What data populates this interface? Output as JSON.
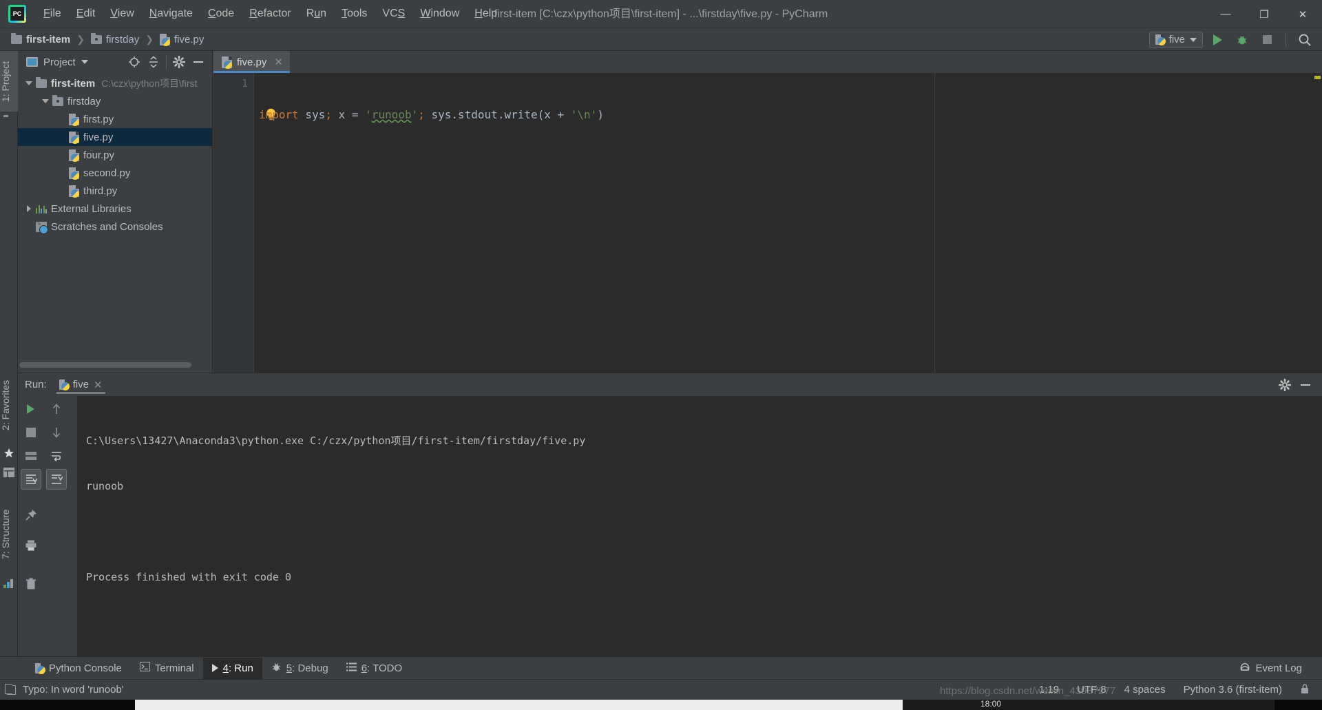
{
  "window": {
    "title": "first-item [C:\\czx\\python项目\\first-item] - ...\\firstday\\five.py - PyCharm",
    "minimize_label": "—",
    "maximize_label": "❐",
    "close_label": "✕"
  },
  "menubar": {
    "items": [
      {
        "label": "File",
        "mnemonic": "F",
        "rest": "ile"
      },
      {
        "label": "Edit",
        "mnemonic": "E",
        "rest": "dit"
      },
      {
        "label": "View",
        "mnemonic": "V",
        "rest": "iew"
      },
      {
        "label": "Navigate",
        "mnemonic": "N",
        "rest": "avigate"
      },
      {
        "label": "Code",
        "mnemonic": "C",
        "rest": "ode"
      },
      {
        "label": "Refactor",
        "mnemonic": "R",
        "rest": "efactor"
      },
      {
        "label": "Run",
        "mnemonic": "R",
        "rest": "un"
      },
      {
        "label": "Tools",
        "mnemonic": "T",
        "rest": "ools"
      },
      {
        "label": "VCS",
        "mnemonic": "S",
        "rest": "VC"
      },
      {
        "label": "Window",
        "mnemonic": "W",
        "rest": "indow"
      },
      {
        "label": "Help",
        "mnemonic": "H",
        "rest": "elp"
      }
    ]
  },
  "navbar": {
    "breadcrumbs": [
      {
        "label": "first-item",
        "icon": "folder-icon"
      },
      {
        "label": "firstday",
        "icon": "source-folder-icon"
      },
      {
        "label": "five.py",
        "icon": "python-file-icon"
      }
    ],
    "separator": "❯",
    "run_config": {
      "label": "five",
      "icon": "python-icon",
      "dropdown": "▾"
    },
    "run_button": "run-button",
    "debug_button": "debug-button",
    "stop_button": "stop-button",
    "search_button": "search-everywhere-button"
  },
  "left_stripe": {
    "tabs": [
      {
        "label": "1: Project",
        "active": true
      },
      {
        "label": "2: Favorites",
        "active": false
      },
      {
        "label": "7: Structure",
        "active": false
      }
    ]
  },
  "project_panel": {
    "title": "Project",
    "dropdown": "▾",
    "buttons": [
      "locate-icon",
      "collapse-all-icon",
      "settings-icon",
      "hide-icon"
    ],
    "tree": [
      {
        "label": "first-item",
        "path": "C:\\czx\\python项目\\first",
        "icon": "folder-icon",
        "twist": "open",
        "indent": 0,
        "bold": true,
        "selected": false
      },
      {
        "label": "firstday",
        "path": "",
        "icon": "source-folder-icon",
        "twist": "open",
        "indent": 1,
        "bold": false,
        "selected": false
      },
      {
        "label": "first.py",
        "path": "",
        "icon": "python-file-icon",
        "twist": "none",
        "indent": 2,
        "bold": false,
        "selected": false
      },
      {
        "label": "five.py",
        "path": "",
        "icon": "python-file-icon",
        "twist": "none",
        "indent": 2,
        "bold": false,
        "selected": true
      },
      {
        "label": "four.py",
        "path": "",
        "icon": "python-file-icon",
        "twist": "none",
        "indent": 2,
        "bold": false,
        "selected": false
      },
      {
        "label": "second.py",
        "path": "",
        "icon": "python-file-icon",
        "twist": "none",
        "indent": 2,
        "bold": false,
        "selected": false
      },
      {
        "label": "third.py",
        "path": "",
        "icon": "python-file-icon",
        "twist": "none",
        "indent": 2,
        "bold": false,
        "selected": false
      },
      {
        "label": "External Libraries",
        "path": "",
        "icon": "library-icon",
        "twist": "closed",
        "indent": 0,
        "bold": false,
        "selected": false
      },
      {
        "label": "Scratches and Consoles",
        "path": "",
        "icon": "scratches-icon",
        "twist": "none",
        "indent": 0,
        "bold": false,
        "selected": false
      }
    ]
  },
  "editor": {
    "tab": {
      "label": "five.py",
      "icon": "python-file-icon",
      "close": "✕"
    },
    "line_number": "1",
    "code": {
      "kw_import": "import",
      "after_import": " sys",
      "semi1": ";",
      "mid": " x = ",
      "quote_open": "'",
      "string_value": "runoob",
      "quote_close": "'",
      "semi2": ";",
      "tail": " sys.stdout.write(x + ",
      "newline_literal": "'\\n'",
      "end": ")"
    },
    "intention_bulb": "intention-bulb-icon"
  },
  "run_panel": {
    "label": "Run:",
    "tab": {
      "label": "five",
      "icon": "python-icon",
      "close": "✕"
    },
    "settings_button": "settings-icon",
    "hide_button": "hide-icon",
    "gutter_buttons": [
      "rerun-button",
      "stop-button",
      "print-layers-button",
      "scroll-down-button"
    ],
    "gutter2_buttons": [
      "up-stack-button",
      "down-stack-button",
      "soft-wrap-button",
      "scroll-to-end-button",
      "pin-button",
      "print-button",
      "clear-all-button"
    ],
    "console": {
      "command": "C:\\Users\\13427\\Anaconda3\\python.exe C:/czx/python项目/first-item/firstday/five.py",
      "output": "runoob",
      "exit": "Process finished with exit code 0"
    }
  },
  "tool_window_bar": {
    "items": [
      {
        "label": "Python Console",
        "icon": "python-icon",
        "active": false,
        "mnemonic": "",
        "rest": "Python Console"
      },
      {
        "label": "Terminal",
        "icon": "terminal-icon",
        "active": false,
        "mnemonic": "",
        "rest": "Terminal"
      },
      {
        "label": "4: Run",
        "icon": "run-icon",
        "active": true,
        "mnemonic": "4",
        "rest": ": Run"
      },
      {
        "label": "5: Debug",
        "icon": "debug-icon",
        "active": false,
        "mnemonic": "5",
        "rest": ": Debug"
      },
      {
        "label": "6: TODO",
        "icon": "todo-icon",
        "active": false,
        "mnemonic": "6",
        "rest": ": TODO"
      }
    ],
    "event_log": {
      "label": "Event Log",
      "icon": "event-log-icon"
    }
  },
  "statusbar": {
    "message": "Typo: In word 'runoob'",
    "caret_position": "1:19",
    "encoding": "UTF-8",
    "indent": "4 spaces",
    "interpreter": "Python 3.6 (first-item)",
    "lock_icon": "lock-icon"
  },
  "watermark": "https://blog.csdn.net/weixin_43987277",
  "taskbar": {
    "clock": "18:00"
  },
  "colors": {
    "background": "#3c3f41",
    "editor_background": "#2b2b2b",
    "accent_blue": "#4a88c7",
    "selection_blue": "#0d293e",
    "green_run": "#59a869",
    "keyword_orange": "#cc7832",
    "string_green": "#6a8759",
    "text": "#bbbbbb"
  }
}
